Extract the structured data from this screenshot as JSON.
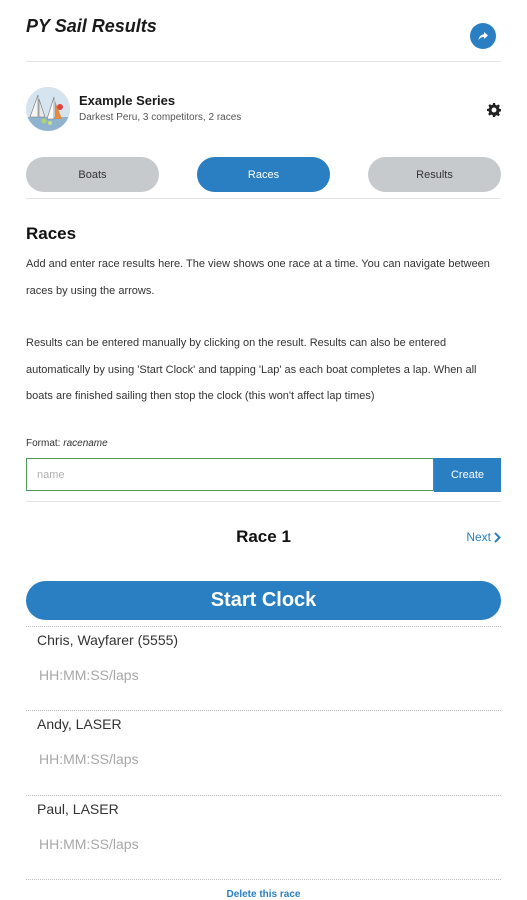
{
  "header": {
    "app_title": "PY Sail Results",
    "share_icon": "share-icon"
  },
  "series": {
    "name": "Example Series",
    "subtitle": "Darkest Peru, 3 competitors, 2 races",
    "settings_icon": "gear-icon"
  },
  "tabs": [
    {
      "label": "Boats",
      "active": false
    },
    {
      "label": "Races",
      "active": true
    },
    {
      "label": "Results",
      "active": false
    }
  ],
  "races_section": {
    "title": "Races",
    "paragraph1": "Add and enter race results here. The view shows one race at a time. You can navigate between races by using the arrows.",
    "paragraph2": "Results can be entered manually by clicking on the result. Results can also be entered automatically by using 'Start Clock' and tapping 'Lap' as each boat completes a lap. When all boats are finished sailing then stop the clock (this won't affect lap times)",
    "format_label": "Format:",
    "format_value": "racename",
    "name_input": {
      "placeholder": "name",
      "value": ""
    },
    "create_label": "Create"
  },
  "race": {
    "title": "Race 1",
    "next_label": "Next",
    "start_clock_label": "Start Clock",
    "competitors": [
      {
        "name": "Chris, Wayfarer (5555)",
        "placeholder": "HH:MM:SS/laps"
      },
      {
        "name": "Andy, LASER",
        "placeholder": "HH:MM:SS/laps"
      },
      {
        "name": "Paul, LASER",
        "placeholder": "HH:MM:SS/laps"
      }
    ],
    "delete_label": "Delete this race"
  },
  "colors": {
    "accent": "#2a7fc3",
    "tab_inactive": "#c7cacd",
    "input_border": "#4b9a5a"
  }
}
